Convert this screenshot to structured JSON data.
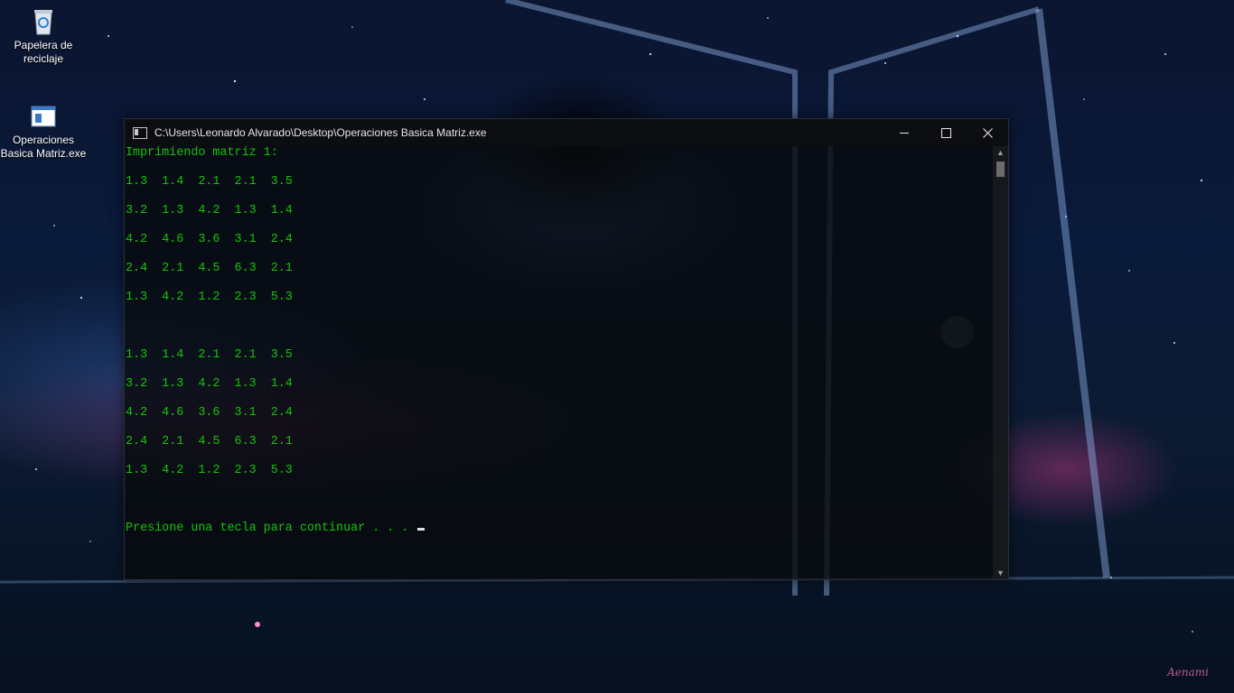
{
  "desktop": {
    "icons": [
      {
        "label": "Papelera de reciclaje",
        "icon": "recycle-bin-icon"
      },
      {
        "label": "Operaciones Basica Matriz.exe",
        "icon": "exe-window-icon"
      }
    ]
  },
  "console": {
    "title": "C:\\Users\\Leonardo Alvarado\\Desktop\\Operaciones Basica Matriz.exe",
    "lines": [
      "Imprimiendo matriz 1:",
      "",
      "1.3  1.4  2.1  2.1  3.5",
      "",
      "3.2  1.3  4.2  1.3  1.4",
      "",
      "4.2  4.6  3.6  3.1  2.4",
      "",
      "2.4  2.1  4.5  6.3  2.1",
      "",
      "1.3  4.2  1.2  2.3  5.3",
      "",
      "",
      "",
      "1.3  1.4  2.1  2.1  3.5",
      "",
      "3.2  1.3  4.2  1.3  1.4",
      "",
      "4.2  4.6  3.6  3.1  2.4",
      "",
      "2.4  2.1  4.5  6.3  2.1",
      "",
      "1.3  4.2  1.2  2.3  5.3",
      "",
      "",
      "",
      "Presione una tecla para continuar . . . "
    ],
    "text_color": "#15c20b",
    "buttons": {
      "minimize": "minimize-icon",
      "maximize": "maximize-icon",
      "close": "close-icon"
    }
  },
  "wallpaper": {
    "signature": "Aenami"
  }
}
